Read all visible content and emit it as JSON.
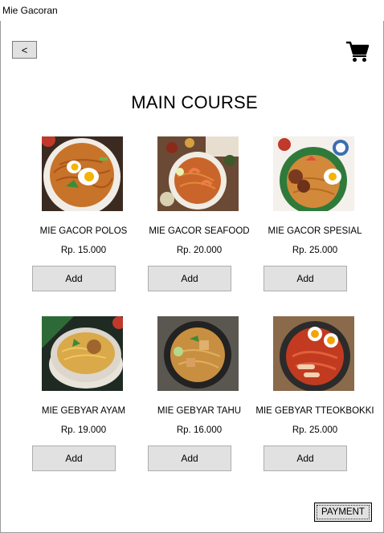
{
  "window": {
    "title": "Mie Gacoran"
  },
  "nav": {
    "back_label": "<"
  },
  "icons": {
    "back": "chevron-left-icon",
    "cart": "cart-icon"
  },
  "page_title": "MAIN COURSE",
  "items": [
    {
      "name": "MIE GACOR POLOS",
      "price": "Rp. 15.000",
      "add_label": "Add"
    },
    {
      "name": "MIE GACOR SEAFOOD",
      "price": "Rp. 20.000",
      "add_label": "Add"
    },
    {
      "name": "MIE GACOR SPESIAL",
      "price": "Rp. 25.000",
      "add_label": "Add"
    },
    {
      "name": "MIE GEBYAR AYAM",
      "price": "Rp. 19.000",
      "add_label": "Add"
    },
    {
      "name": "MIE GEBYAR TAHU",
      "price": "Rp. 16.000",
      "add_label": "Add"
    },
    {
      "name": "MIE GEBYAR TTEOKBOKKI",
      "price": "Rp. 25.000",
      "add_label": "Add"
    }
  ],
  "payment_label": "PAYMENT"
}
